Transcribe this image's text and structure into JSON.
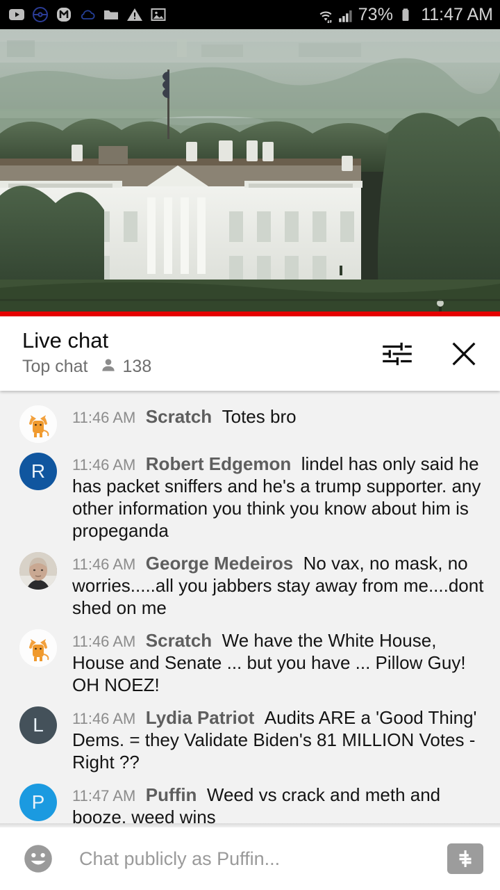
{
  "status_bar": {
    "icons": [
      "youtube-icon",
      "pokeball-icon",
      "m-app-icon",
      "cloud-icon",
      "folder-icon",
      "warning-icon",
      "photos-icon"
    ],
    "wifi": "wifi-icon",
    "signal": "cell-signal-icon",
    "battery_percent": "73%",
    "battery": "battery-icon",
    "time": "11:47 AM"
  },
  "video": {
    "label": "white-house-live-stream",
    "progress_color": "#e60000",
    "progress_percent": 100
  },
  "chat_header": {
    "title": "Live chat",
    "subtitle": "Top chat",
    "viewer_count": "138",
    "viewer_icon": "person-icon",
    "settings_icon": "tune-sliders-icon",
    "close_icon": "close-icon"
  },
  "messages": [
    {
      "time": "11:46 AM",
      "author": "Scratch",
      "text": "Totes bro",
      "avatar_type": "cat",
      "avatar_letter": "",
      "avatar_color": "#fdfdfd"
    },
    {
      "time": "11:46 AM",
      "author": "Robert Edgemon",
      "text": "lindel has only said he has packet sniffers and he's a trump supporter. any other information you think you know about him is propeganda",
      "avatar_type": "letter",
      "avatar_letter": "R",
      "avatar_color": "#10569f"
    },
    {
      "time": "11:46 AM",
      "author": "George Medeiros",
      "text": "No vax, no mask, no worries.....all you jabbers stay away from me....dont shed on me",
      "avatar_type": "photo",
      "avatar_letter": "",
      "avatar_color": "#b3a99c"
    },
    {
      "time": "11:46 AM",
      "author": "Scratch",
      "text": "We have the White House, House and Senate ... but you have ... Pillow Guy! OH NOEZ!",
      "avatar_type": "cat",
      "avatar_letter": "",
      "avatar_color": "#fdfdfd"
    },
    {
      "time": "11:46 AM",
      "author": "Lydia Patriot",
      "text": "Audits ARE a 'Good Thing' Dems. = they Validate Biden's 81 MILLION Votes - Right ??",
      "avatar_type": "letter",
      "avatar_letter": "L",
      "avatar_color": "#44515a"
    },
    {
      "time": "11:47 AM",
      "author": "Puffin",
      "text": "Weed vs crack and meth and booze. weed wins",
      "avatar_type": "letter",
      "avatar_letter": "P",
      "avatar_color": "#1b9ae0"
    }
  ],
  "input_bar": {
    "emoji_icon": "emoji-smiley-icon",
    "placeholder": "Chat publicly as Puffin...",
    "value": "",
    "superchat_icon": "dollar-sign-icon"
  }
}
